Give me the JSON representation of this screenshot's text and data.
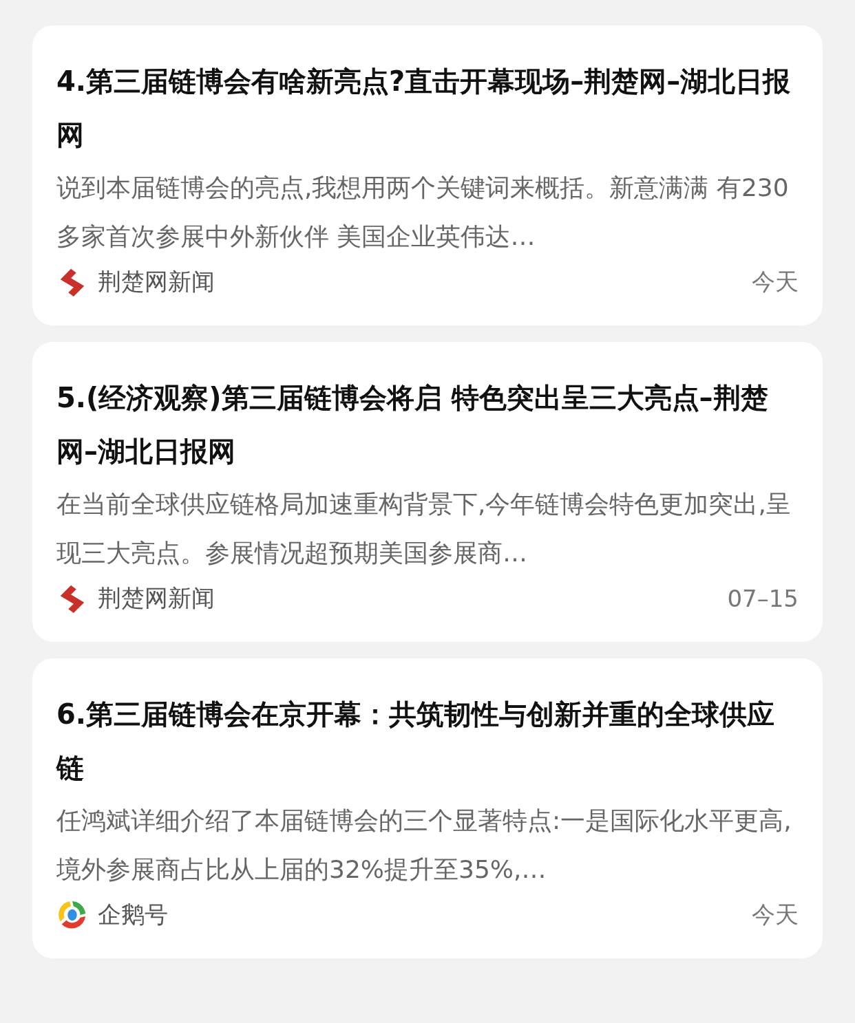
{
  "articles": [
    {
      "title": "4.第三届链博会有啥新亮点?直击开幕现场–荆楚网–湖北日报网",
      "snippet": "说到本届链博会的亮点,我想用两个关键词来概括。新意满满 有230多家首次参展中外新伙伴 美国企业英伟达…",
      "source": {
        "kind": "brush",
        "name": "荆楚网新闻"
      },
      "time": "今天"
    },
    {
      "title": "5.(经济观察)第三届链博会将启 特色突出呈三大亮点–荆楚网–湖北日报网",
      "snippet": "在当前全球供应链格局加速重构背景下,今年链博会特色更加突出,呈现三大亮点。参展情况超预期美国参展商…",
      "source": {
        "kind": "brush",
        "name": "荆楚网新闻"
      },
      "time": "07–15"
    },
    {
      "title": "6.第三届链博会在京开幕：共筑韧性与创新并重的全球供应链",
      "snippet": "任鸿斌详细介绍了本届链博会的三个显著特点:一是国际化水平更高,境外参展商占比从上届的32%提升至35%,…",
      "source": {
        "kind": "ring",
        "name": "企鹅号"
      },
      "time": "今天"
    }
  ]
}
